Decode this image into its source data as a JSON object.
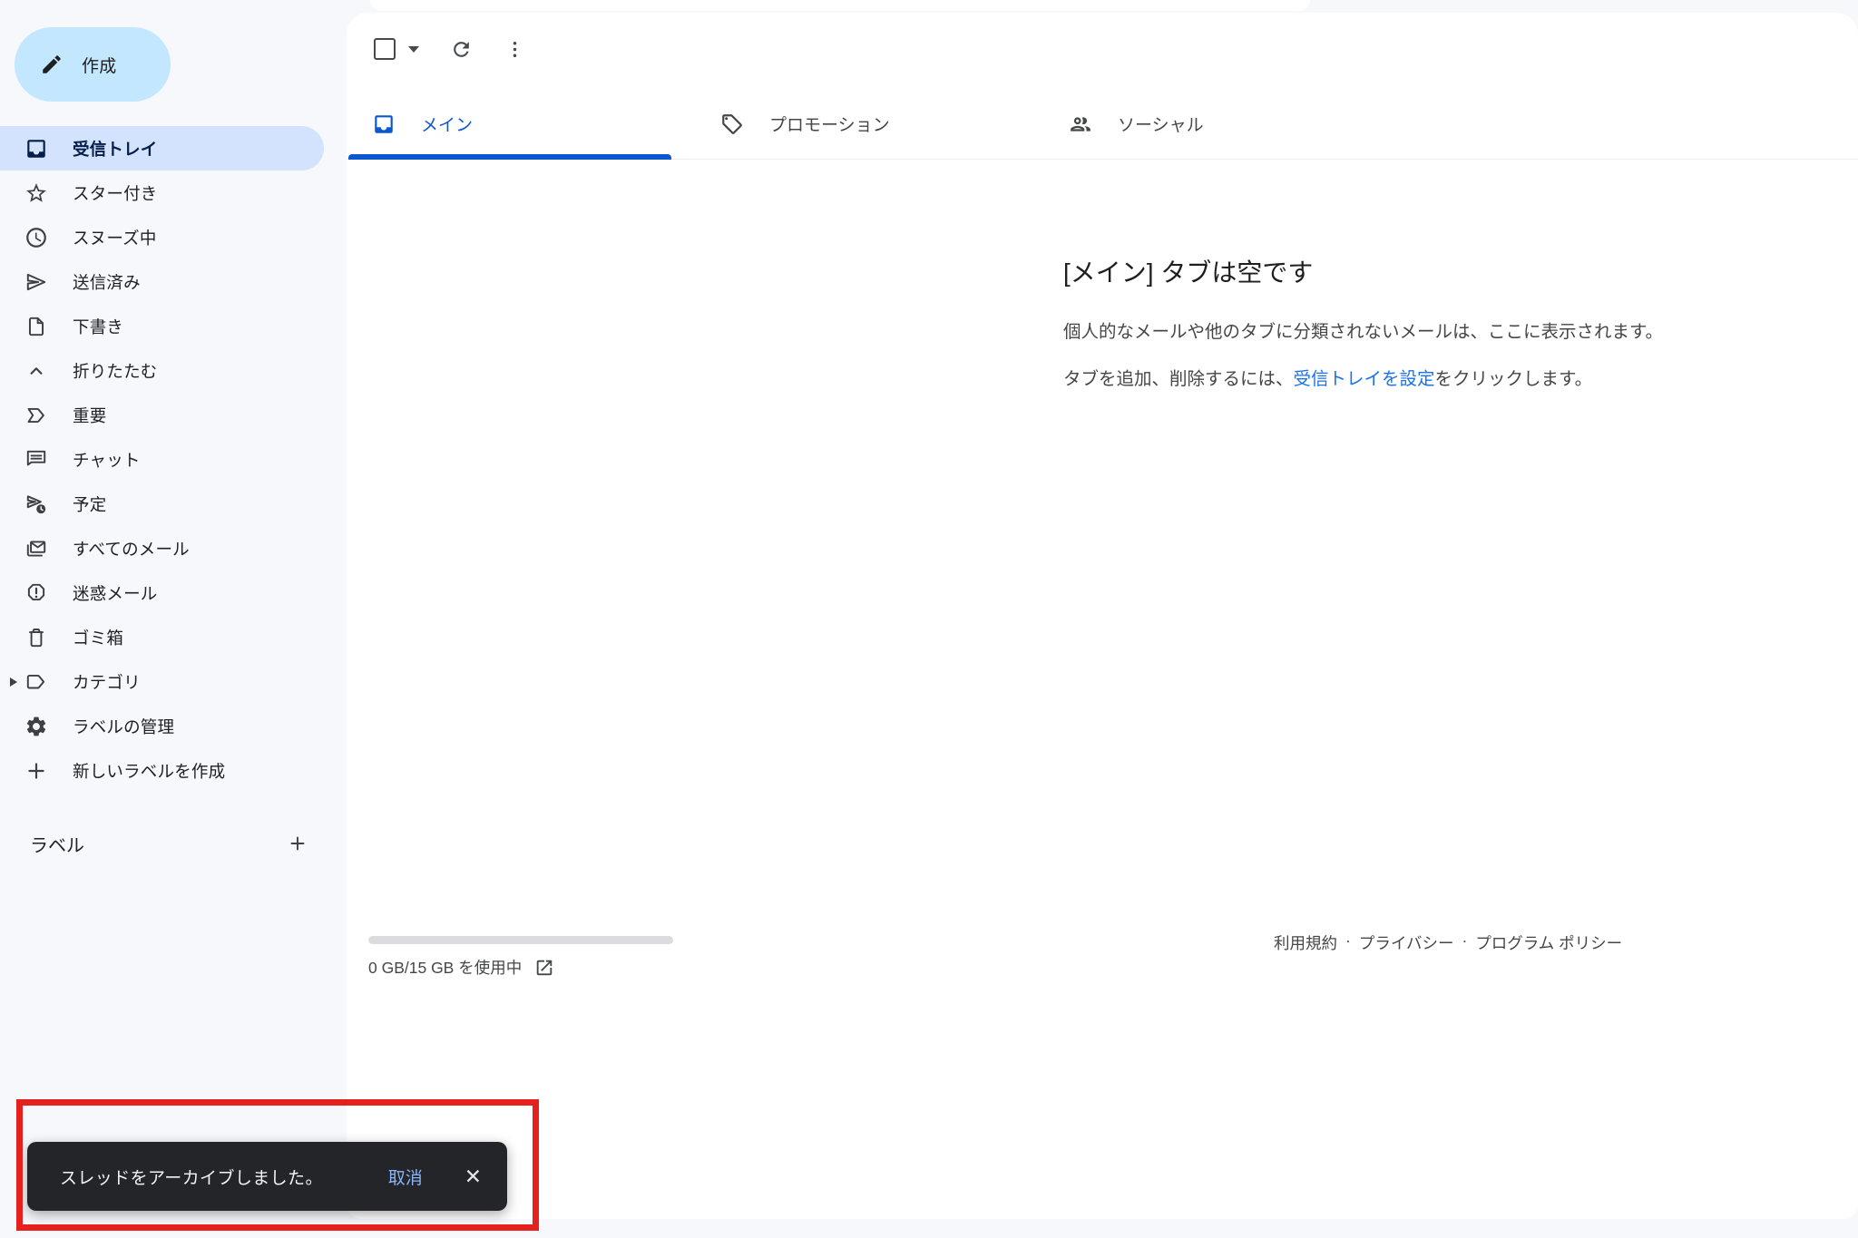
{
  "sidebar": {
    "compose_label": "作成",
    "items": [
      {
        "label": "受信トレイ",
        "icon": "inbox-icon",
        "selected": true
      },
      {
        "label": "スター付き",
        "icon": "star-icon"
      },
      {
        "label": "スヌーズ中",
        "icon": "clock-icon"
      },
      {
        "label": "送信済み",
        "icon": "send-icon"
      },
      {
        "label": "下書き",
        "icon": "draft-icon"
      },
      {
        "label": "折りたたむ",
        "icon": "chevron-up-icon"
      },
      {
        "label": "重要",
        "icon": "important-icon"
      },
      {
        "label": "チャット",
        "icon": "chat-icon"
      },
      {
        "label": "予定",
        "icon": "scheduled-send-icon"
      },
      {
        "label": "すべてのメール",
        "icon": "all-mail-icon"
      },
      {
        "label": "迷惑メール",
        "icon": "spam-icon"
      },
      {
        "label": "ゴミ箱",
        "icon": "trash-icon"
      },
      {
        "label": "カテゴリ",
        "icon": "label-icon",
        "expandable": true
      },
      {
        "label": "ラベルの管理",
        "icon": "gear-icon"
      },
      {
        "label": "新しいラベルを作成",
        "icon": "plus-icon"
      }
    ],
    "labels_header": "ラベル"
  },
  "toolbar": {
    "icons": [
      "select-checkbox",
      "caret-down-icon",
      "refresh-icon",
      "more-vert-icon"
    ]
  },
  "tabs": [
    {
      "label": "メイン",
      "icon": "inbox-tab-icon",
      "active": true
    },
    {
      "label": "プロモーション",
      "icon": "tag-icon",
      "active": false
    },
    {
      "label": "ソーシャル",
      "icon": "people-icon",
      "active": false
    }
  ],
  "empty_state": {
    "title": "[メイン] タブは空です",
    "line1": "個人的なメールや他のタブに分類されないメールは、ここに表示されます。",
    "line2_prefix": "タブを追加、削除するには、",
    "line2_link": "受信トレイを設定",
    "line2_suffix": "をクリックします。"
  },
  "storage": {
    "usage_text": "0 GB/15 GB を使用中",
    "progress_percent": 0
  },
  "footer": {
    "links": [
      "利用規約",
      "プライバシー",
      "プログラム ポリシー"
    ],
    "separator": "·"
  },
  "toast": {
    "message": "スレッドをアーカイブしました。",
    "undo_label": "取消",
    "close_glyph": "✕"
  },
  "colors": {
    "accent_blue": "#0b57d0",
    "link_blue": "#1a73e8",
    "compose_bg": "#c2e7ff",
    "selected_row_bg": "#d3e3fd",
    "toast_bg": "#242529",
    "undo_blue": "#8ab4f8",
    "annotation_red": "#e6201d",
    "page_bg": "#f6f8fc"
  }
}
